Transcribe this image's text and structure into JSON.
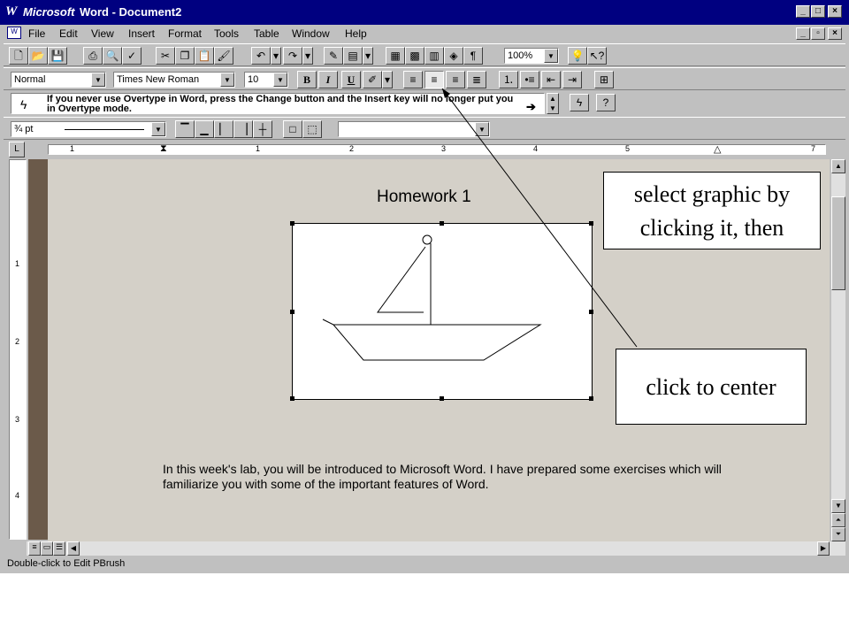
{
  "window": {
    "brand": "Microsoft",
    "title": "Word - Document2"
  },
  "menu": [
    "File",
    "Edit",
    "View",
    "Insert",
    "Format",
    "Tools",
    "Table",
    "Window",
    "Help"
  ],
  "toolbar": {
    "zoom": "100%"
  },
  "format": {
    "style": "Normal",
    "font": "Times New Roman",
    "size": "10",
    "bold": "B",
    "italic": "I",
    "underline": "U"
  },
  "tip": {
    "text": "If you never use Overtype in Word, press the Change button and the Insert key will no longer put you in Overtype mode."
  },
  "borders": {
    "line_weight": "¾ pt"
  },
  "ruler": {
    "numbers": [
      "1",
      "1",
      "2",
      "3",
      "4",
      "5",
      "7"
    ]
  },
  "vruler": {
    "numbers": [
      "1",
      "2",
      "3",
      "4"
    ]
  },
  "document": {
    "title": "Homework 1",
    "body": "In this week's lab, you will be introduced to Microsoft Word. I have prepared some exercises which will familiarize you with some of the important features of Word."
  },
  "status": {
    "text": "Double-click to Edit PBrush"
  },
  "callouts": {
    "select": "select graphic by clicking it, then",
    "center": "click to center"
  },
  "colors": {
    "titlebar": "#000080",
    "face": "#c0c0c0",
    "doc_bg": "#d4d0c8"
  }
}
